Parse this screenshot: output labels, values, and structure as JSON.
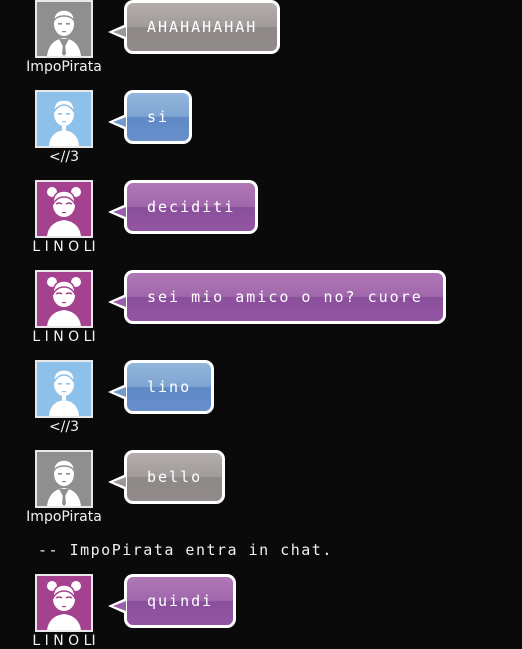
{
  "messages": [
    {
      "user": "ImpoPirata",
      "text": "AHAHAHAHAH",
      "style": "gray"
    },
    {
      "user": "<//3",
      "text": "si",
      "style": "blue"
    },
    {
      "user": "L I N O LI",
      "text": "deciditi",
      "style": "purple"
    },
    {
      "user": "L I N O LI",
      "text": "sei mio amico o no? cuore",
      "style": "purple"
    },
    {
      "user": "<//3",
      "text": "lino",
      "style": "blue"
    },
    {
      "user": "ImpoPirata",
      "text": "bello",
      "style": "gray"
    },
    {
      "user": "L I N O LI",
      "text": "quindi",
      "style": "purple"
    }
  ],
  "system_message": "-- ImpoPirata entra in chat.",
  "colors": {
    "background": "#0a0a0a",
    "gray_bubble": "#a19c9b",
    "blue_bubble": "#7ea5d2",
    "purple_bubble": "#a068ac",
    "bubble_border": "#ffffff"
  },
  "icons": {
    "gray": "male-avatar-icon",
    "blue": "boy-avatar-icon",
    "purple": "girl-avatar-icon"
  }
}
